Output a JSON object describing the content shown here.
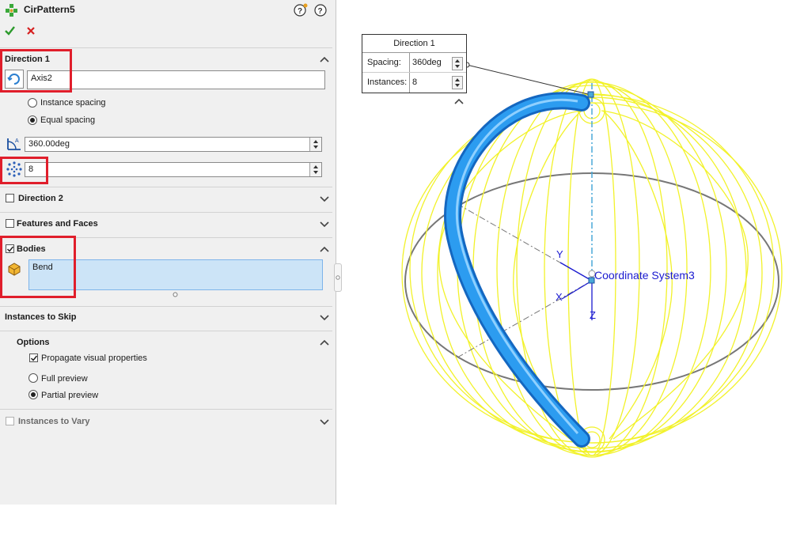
{
  "feature": {
    "title": "CirPattern5",
    "ok_icon": "checkmark-icon",
    "cancel_icon": "close-icon"
  },
  "direction1": {
    "header": "Direction 1",
    "axis_value": "Axis2",
    "option_instance_spacing": "Instance spacing",
    "option_equal_spacing": "Equal spacing",
    "selected_option": "Equal spacing",
    "angle_value": "360.00deg",
    "instances_value": "8"
  },
  "direction2": {
    "header": "Direction 2",
    "checked": false
  },
  "features_faces": {
    "header": "Features and Faces",
    "checked": false
  },
  "bodies": {
    "header": "Bodies",
    "checked": true,
    "items": [
      "Bend"
    ]
  },
  "instances_to_skip": {
    "header": "Instances to Skip"
  },
  "options": {
    "header": "Options",
    "propagate_label": "Propagate visual properties",
    "propagate_checked": true,
    "full_preview": "Full preview",
    "partial_preview": "Partial preview",
    "selected_preview": "Partial preview"
  },
  "instances_to_vary": {
    "header": "Instances to Vary",
    "checked": false
  },
  "callout": {
    "title": "Direction 1",
    "spacing_label": "Spacing:",
    "spacing_value": "360deg",
    "instances_label": "Instances:",
    "instances_value": "8"
  },
  "viewport": {
    "coord_system_label": "Coordinate System3",
    "axis_y": "Y",
    "axis_x": "X",
    "axis_z": "Z"
  },
  "colors": {
    "highlight_red": "#e01e2b",
    "selection_blue": "#cce4f7",
    "pattern_yellow": "#f2f22a",
    "body_blue": "#1e8ee0",
    "axis_blue": "#1a1ad0"
  }
}
